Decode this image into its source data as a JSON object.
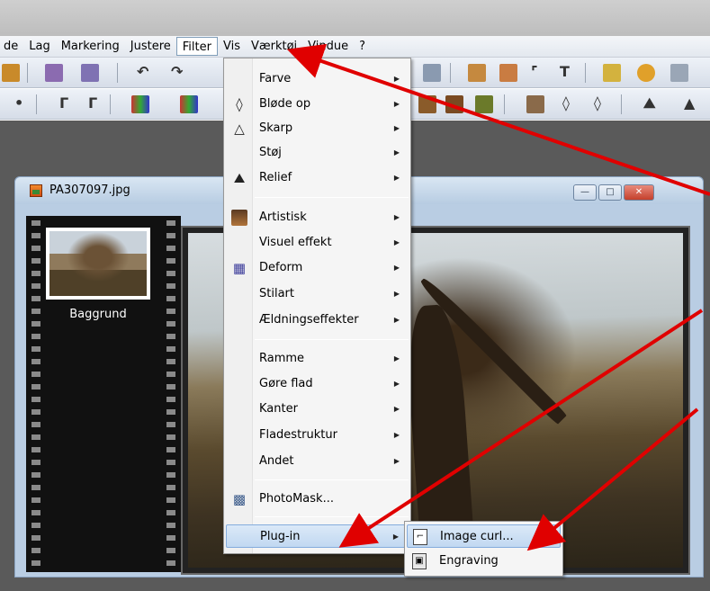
{
  "menubar": {
    "items": [
      "de",
      "Lag",
      "Markering",
      "Justere",
      "Filter",
      "Vis",
      "Værktøj",
      "Vindue",
      "?"
    ],
    "active": "Filter"
  },
  "document": {
    "title": "PA307097.jpg",
    "layer_label": "Baggrund"
  },
  "filter_menu": {
    "items": [
      {
        "label": "Farve",
        "icon": "",
        "submenu": true
      },
      {
        "label": "Bløde op",
        "icon": "drop-icon",
        "submenu": true
      },
      {
        "label": "Skarp",
        "icon": "triangle-icon",
        "submenu": true
      },
      {
        "label": "Støj",
        "icon": "",
        "submenu": true
      },
      {
        "label": "Relief",
        "icon": "relief-icon",
        "submenu": true
      },
      {
        "label": "Artistisk",
        "icon": "portrait-icon",
        "submenu": true
      },
      {
        "label": "Visuel effekt",
        "icon": "",
        "submenu": true
      },
      {
        "label": "Deform",
        "icon": "grid-icon",
        "submenu": true
      },
      {
        "label": "Stilart",
        "icon": "",
        "submenu": true
      },
      {
        "label": "Ældningseffekter",
        "icon": "",
        "submenu": true
      },
      {
        "label": "Ramme",
        "icon": "",
        "submenu": true
      },
      {
        "label": "Gøre flad",
        "icon": "",
        "submenu": true
      },
      {
        "label": "Kanter",
        "icon": "",
        "submenu": true
      },
      {
        "label": "Fladestruktur",
        "icon": "",
        "submenu": true
      },
      {
        "label": "Andet",
        "icon": "",
        "submenu": true
      },
      {
        "label": "PhotoMask...",
        "icon": "photomask-icon",
        "submenu": false
      },
      {
        "label": "Plug-in",
        "icon": "",
        "submenu": true,
        "highlighted": true
      }
    ]
  },
  "plugin_submenu": {
    "items": [
      {
        "label": "Image curl...",
        "icon": "page-curl-icon",
        "highlighted": true
      },
      {
        "label": "Engraving",
        "icon": "engraving-icon",
        "highlighted": false
      }
    ]
  },
  "annotation_color": "#e00000"
}
